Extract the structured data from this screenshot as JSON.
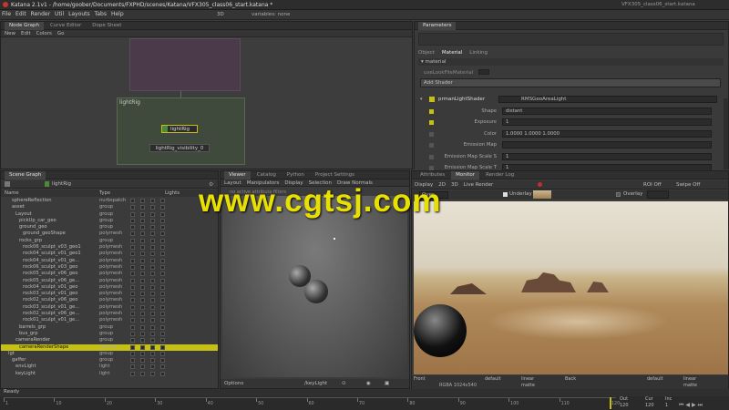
{
  "window": {
    "title": "Katana 2.1v1 - /home/goober/Documents/FXPHD/scenes/Katana/VFX305_class06_start.katana *",
    "right_title": "VFX305_class06_start.katana"
  },
  "menu": [
    "File",
    "Edit",
    "Render",
    "Util",
    "Layouts",
    "Tabs",
    "Help"
  ],
  "toolbar": {
    "variables": "variables: none",
    "resolution": "3D"
  },
  "node_graph": {
    "tabs": [
      "Node Graph",
      "Curve Editor",
      "Dope Sheet"
    ],
    "menu": [
      "New",
      "Edit",
      "Colors",
      "Go"
    ],
    "backdrop_label": "lightRig",
    "node_main": "lightRig",
    "node_vis": "lightRig_visibility_0"
  },
  "parameters": {
    "tab": "Parameters",
    "subtabs": [
      "Object",
      "Material",
      "Linking"
    ],
    "group": "material",
    "use_look": "useLookFileMaterial",
    "add_shader": "Add Shader",
    "shader_label": "prmanLightShader",
    "shader_value": "RMSGeoAreaLight",
    "rows": [
      {
        "label": "Shape",
        "value": "distant"
      },
      {
        "label": "Exposure",
        "value": "1"
      },
      {
        "label": "Color",
        "value": "1.0000   1.0000   1.0000"
      },
      {
        "label": "Emission Map",
        "value": ""
      },
      {
        "label": "Emission Map Scale S",
        "value": "1"
      },
      {
        "label": "Emission Map Scale T",
        "value": "1"
      }
    ]
  },
  "scene_graph": {
    "tab": "Scene Graph",
    "filter": "lightRig",
    "headers": [
      "Name",
      "Type",
      "Lights"
    ],
    "rows": [
      {
        "name": "sphereReflection",
        "type": "nurbspatch",
        "indent": 3
      },
      {
        "name": "asset",
        "type": "group",
        "indent": 3
      },
      {
        "name": "Layout",
        "type": "group",
        "indent": 4
      },
      {
        "name": "pickUp_car_geo",
        "type": "group",
        "indent": 5
      },
      {
        "name": "ground_geo",
        "type": "group",
        "indent": 5
      },
      {
        "name": "ground_geoShape",
        "type": "polymesh",
        "indent": 6
      },
      {
        "name": "rocks_grp",
        "type": "group",
        "indent": 5
      },
      {
        "name": "rock06_sculpt_v03_geo1",
        "type": "polymesh",
        "indent": 6
      },
      {
        "name": "rock04_sculpt_v01_geo1",
        "type": "polymesh",
        "indent": 6
      },
      {
        "name": "rock04_sculpt_v01_ge...",
        "type": "polymesh",
        "indent": 6
      },
      {
        "name": "rock06_sculpt_v03_geo",
        "type": "polymesh",
        "indent": 6
      },
      {
        "name": "rock05_sculpt_v06_geo",
        "type": "polymesh",
        "indent": 6
      },
      {
        "name": "rock05_sculpt_v06_ge...",
        "type": "polymesh",
        "indent": 6
      },
      {
        "name": "rock04_sculpt_v01_geo",
        "type": "polymesh",
        "indent": 6
      },
      {
        "name": "rock03_sculpt_v01_geo",
        "type": "polymesh",
        "indent": 6
      },
      {
        "name": "rock02_sculpt_v06_geo",
        "type": "polymesh",
        "indent": 6
      },
      {
        "name": "rock03_sculpt_v01_ge...",
        "type": "polymesh",
        "indent": 6
      },
      {
        "name": "rock02_sculpt_v06_ge...",
        "type": "polymesh",
        "indent": 6
      },
      {
        "name": "rock01_sculpt_v01_ge...",
        "type": "polymesh",
        "indent": 6
      },
      {
        "name": "barrels_grp",
        "type": "group",
        "indent": 5
      },
      {
        "name": "bus_grp",
        "type": "group",
        "indent": 5
      },
      {
        "name": "cameraRender",
        "type": "group",
        "indent": 4
      },
      {
        "name": "cameraRenderShape",
        "type": "camera",
        "indent": 5,
        "selected": true
      },
      {
        "name": "lgt",
        "type": "group",
        "indent": 2
      },
      {
        "name": "gaffer",
        "type": "group",
        "indent": 3
      },
      {
        "name": "envLight",
        "type": "light",
        "indent": 4
      },
      {
        "name": "keyLight",
        "type": "light",
        "indent": 4
      }
    ]
  },
  "viewer": {
    "tabs": [
      "Viewer",
      "Catalog",
      "Python",
      "Project Settings"
    ],
    "menu": [
      "Layout",
      "Manipulators",
      "Display",
      "Selection",
      "Draw Normals"
    ],
    "notice": "no active attribute filters",
    "options": "Options",
    "camera": "/keyLight"
  },
  "monitor": {
    "tabs": [
      "Attributes",
      "Monitor",
      "Render Log"
    ],
    "menu": [
      "Display",
      "2D",
      "3D",
      "Live Render"
    ],
    "roi": "ROI Off",
    "swipe": "Swipe Off",
    "over": "Over",
    "underlay": "Underlay",
    "overlay": "Overlay",
    "front": "Front",
    "info": "RGBA 1024x540",
    "color_space": "linear",
    "default": "default",
    "matte": "matte",
    "back": "Back"
  },
  "watermark": "www.cgtsj.com",
  "status": {
    "text": "Ready"
  },
  "timeline": {
    "ticks": [
      "1",
      "10",
      "20",
      "30",
      "40",
      "50",
      "60",
      "70",
      "80",
      "90",
      "100",
      "110",
      "120"
    ],
    "out": "120",
    "cur": "120",
    "inc": "1",
    "start": "120",
    "end": "120",
    "inc_val": "1",
    "labels": [
      "Out",
      "Cur",
      "Inc"
    ]
  },
  "colors": {
    "accent": "#c6c016",
    "node_green": "#4a8a3a",
    "watermark": "#e8e000"
  }
}
